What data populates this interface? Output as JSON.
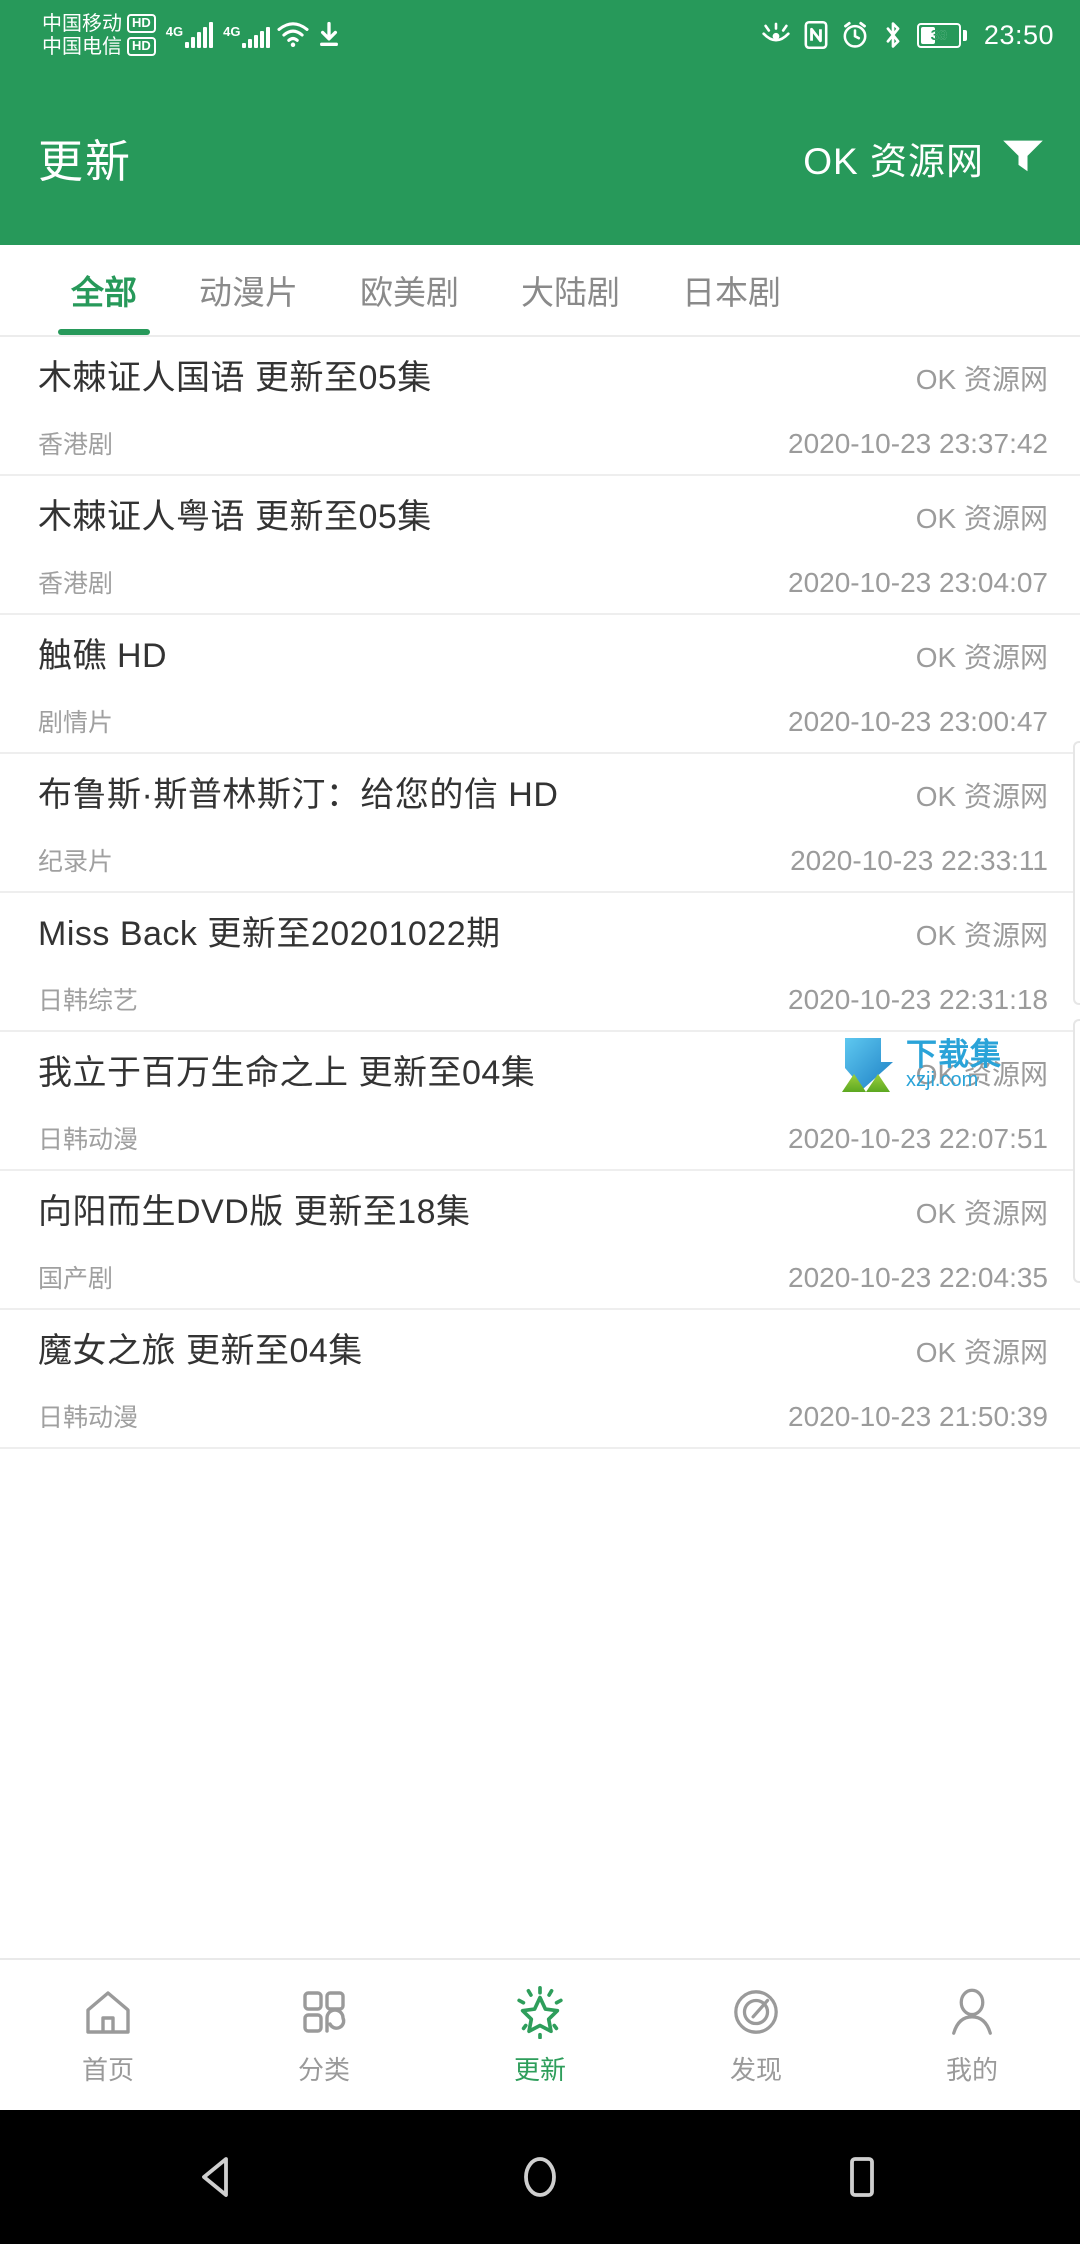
{
  "status_bar": {
    "carriers": [
      {
        "name": "中国移动",
        "badge": "HD",
        "gen": "4G"
      },
      {
        "name": "中国电信",
        "badge": "HD",
        "gen": "4G"
      }
    ],
    "icons": [
      "wifi-icon",
      "download-icon",
      "eye-comfort-icon",
      "nfc-icon",
      "alarm-icon",
      "bluetooth-icon"
    ],
    "battery_percent": "39",
    "time": "23:50"
  },
  "header": {
    "title": "更新",
    "source_label": "OK 资源网",
    "filter_icon": "filter-icon",
    "background_color": "#27995a"
  },
  "tabs": {
    "active_index": 0,
    "items": [
      {
        "label": "全部"
      },
      {
        "label": "动漫片"
      },
      {
        "label": "欧美剧"
      },
      {
        "label": "大陆剧"
      },
      {
        "label": "日本剧"
      }
    ],
    "active_color": "#27995a"
  },
  "list": {
    "rows": [
      {
        "title": "木棘证人国语 更新至05集",
        "source": "OK 资源网",
        "category": "香港剧",
        "time": "2020-10-23 23:37:42"
      },
      {
        "title": "木棘证人粤语 更新至05集",
        "source": "OK 资源网",
        "category": "香港剧",
        "time": "2020-10-23 23:04:07"
      },
      {
        "title": "触礁 HD",
        "source": "OK 资源网",
        "category": "剧情片",
        "time": "2020-10-23 23:00:47"
      },
      {
        "title": "布鲁斯·斯普林斯汀：给您的信 HD",
        "source": "OK 资源网",
        "category": "纪录片",
        "time": "2020-10-23 22:33:11"
      },
      {
        "title": "Miss Back 更新至20201022期",
        "source": "OK 资源网",
        "category": "日韩综艺",
        "time": "2020-10-23 22:31:18"
      },
      {
        "title": "我立于百万生命之上 更新至04集",
        "source": "OK 资源网",
        "category": "日韩动漫",
        "time": "2020-10-23 22:07:51"
      },
      {
        "title": "向阳而生DVD版 更新至18集",
        "source": "OK 资源网",
        "category": "国产剧",
        "time": "2020-10-23 22:04:35"
      },
      {
        "title": "魔女之旅 更新至04集",
        "source": "OK 资源网",
        "category": "日韩动漫",
        "time": "2020-10-23 21:50:39"
      }
    ]
  },
  "watermark": {
    "main": "下载集",
    "sub": "xzji.com",
    "icon": "download-arrow-icon",
    "color": "#2aa3d8"
  },
  "bottom_nav": {
    "active_index": 2,
    "active_color": "#2e9e5b",
    "items": [
      {
        "label": "首页",
        "icon": "home-icon"
      },
      {
        "label": "分类",
        "icon": "grid-icon"
      },
      {
        "label": "更新",
        "icon": "star-icon"
      },
      {
        "label": "发现",
        "icon": "compass-icon"
      },
      {
        "label": "我的",
        "icon": "person-icon"
      }
    ]
  },
  "android_nav": {
    "items": [
      {
        "icon": "back-triangle-icon"
      },
      {
        "icon": "home-circle-icon"
      },
      {
        "icon": "recents-square-icon"
      }
    ]
  }
}
